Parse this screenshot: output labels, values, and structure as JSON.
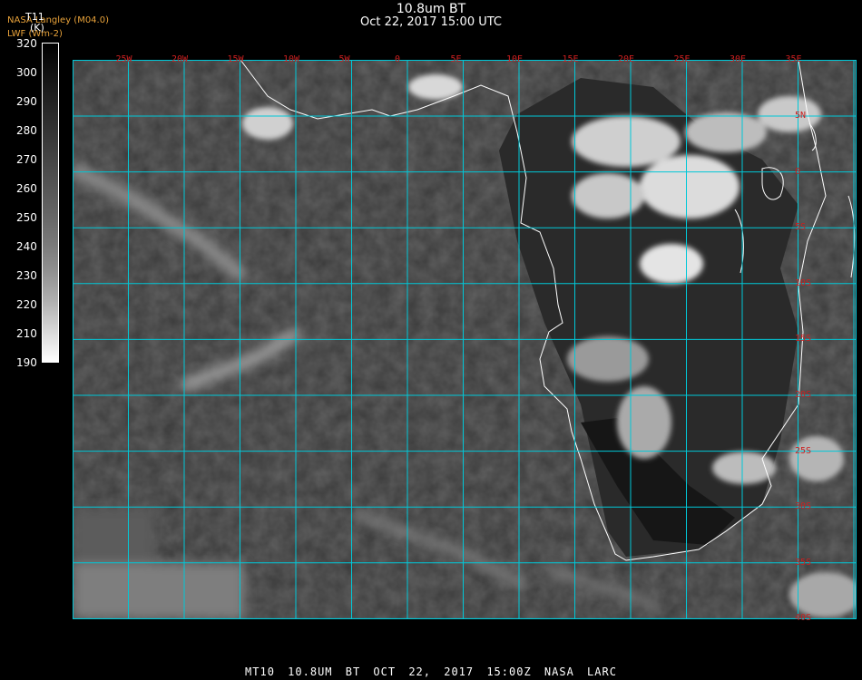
{
  "header": {
    "title": "10.8um BT",
    "datetime": "Oct 22, 2017 15:00 UTC",
    "credit_line1": "NASA Langley (M04.0)",
    "credit_line2": "LWF (Wm-2)"
  },
  "colorbar": {
    "variable": "T11",
    "unit": "(K)",
    "ticks": [
      "320",
      "300",
      "290",
      "280",
      "270",
      "260",
      "250",
      "240",
      "230",
      "220",
      "210",
      "190"
    ]
  },
  "map": {
    "lon_labels": [
      "25W",
      "20W",
      "15W",
      "10W",
      "5W",
      "0",
      "5E",
      "10E",
      "15E",
      "20E",
      "25E",
      "30E",
      "35E"
    ],
    "lat_labels": [
      "5N",
      "0",
      "5S",
      "10S",
      "15S",
      "20S",
      "25S",
      "30S",
      "35S",
      "40S"
    ],
    "grid_color": "#00c8d8",
    "label_color": "#cc2020",
    "coast_color": "#ffffff"
  },
  "footer": {
    "text": "MT10  10.8UM BT  OCT 22, 2017 15:00Z  NASA LARC"
  }
}
